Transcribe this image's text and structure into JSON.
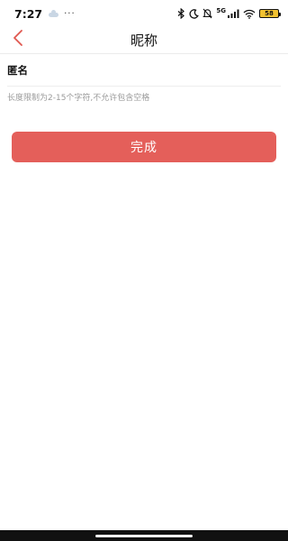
{
  "status_bar": {
    "time": "7:27",
    "more": "···",
    "network_label": "5G",
    "battery_level": "58"
  },
  "nav": {
    "title": "昵称",
    "back_icon": "chevron-left-icon",
    "back_color": "#e0574f"
  },
  "form": {
    "name_value": "匿名",
    "hint": "长度限制为2-15个字符,不允许包含空格"
  },
  "actions": {
    "done_label": "完成",
    "done_color": "#e45f5a"
  }
}
